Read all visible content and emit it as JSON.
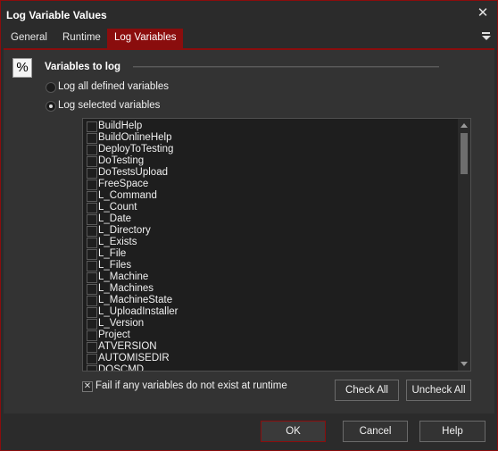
{
  "window": {
    "title": "Log Variable Values",
    "close_glyph": "✕"
  },
  "tabs": [
    {
      "label": "General"
    },
    {
      "label": "Runtime"
    },
    {
      "label": "Log Variables"
    }
  ],
  "group": {
    "icon_glyph": "%",
    "title": "Variables to log"
  },
  "radios": [
    {
      "label": "Log all defined variables",
      "selected": false
    },
    {
      "label": "Log selected variables",
      "selected": true
    }
  ],
  "variables": [
    "BuildHelp",
    "BuildOnlineHelp",
    "DeployToTesting",
    "DoTesting",
    "DoTestsUpload",
    "FreeSpace",
    "L_Command",
    "L_Count",
    "L_Date",
    "L_Directory",
    "L_Exists",
    "L_File",
    "L_Files",
    "L_Machine",
    "L_Machines",
    "L_MachineState",
    "L_UploadInstaller",
    "L_Version",
    "Project",
    "ATVERSION",
    "AUTOMISEDIR",
    "DOSCMD"
  ],
  "fail_option": {
    "label": "Fail if any variables do not exist at runtime",
    "checked": true,
    "glyph": "✕"
  },
  "buttons": {
    "check_all": "Check All",
    "uncheck_all": "Uncheck All",
    "ok": "OK",
    "cancel": "Cancel",
    "help": "Help"
  },
  "colors": {
    "accent": "#8a0d0d",
    "background": "#2b2b2b",
    "panel": "#333333",
    "list_background": "#1e1e1e"
  }
}
